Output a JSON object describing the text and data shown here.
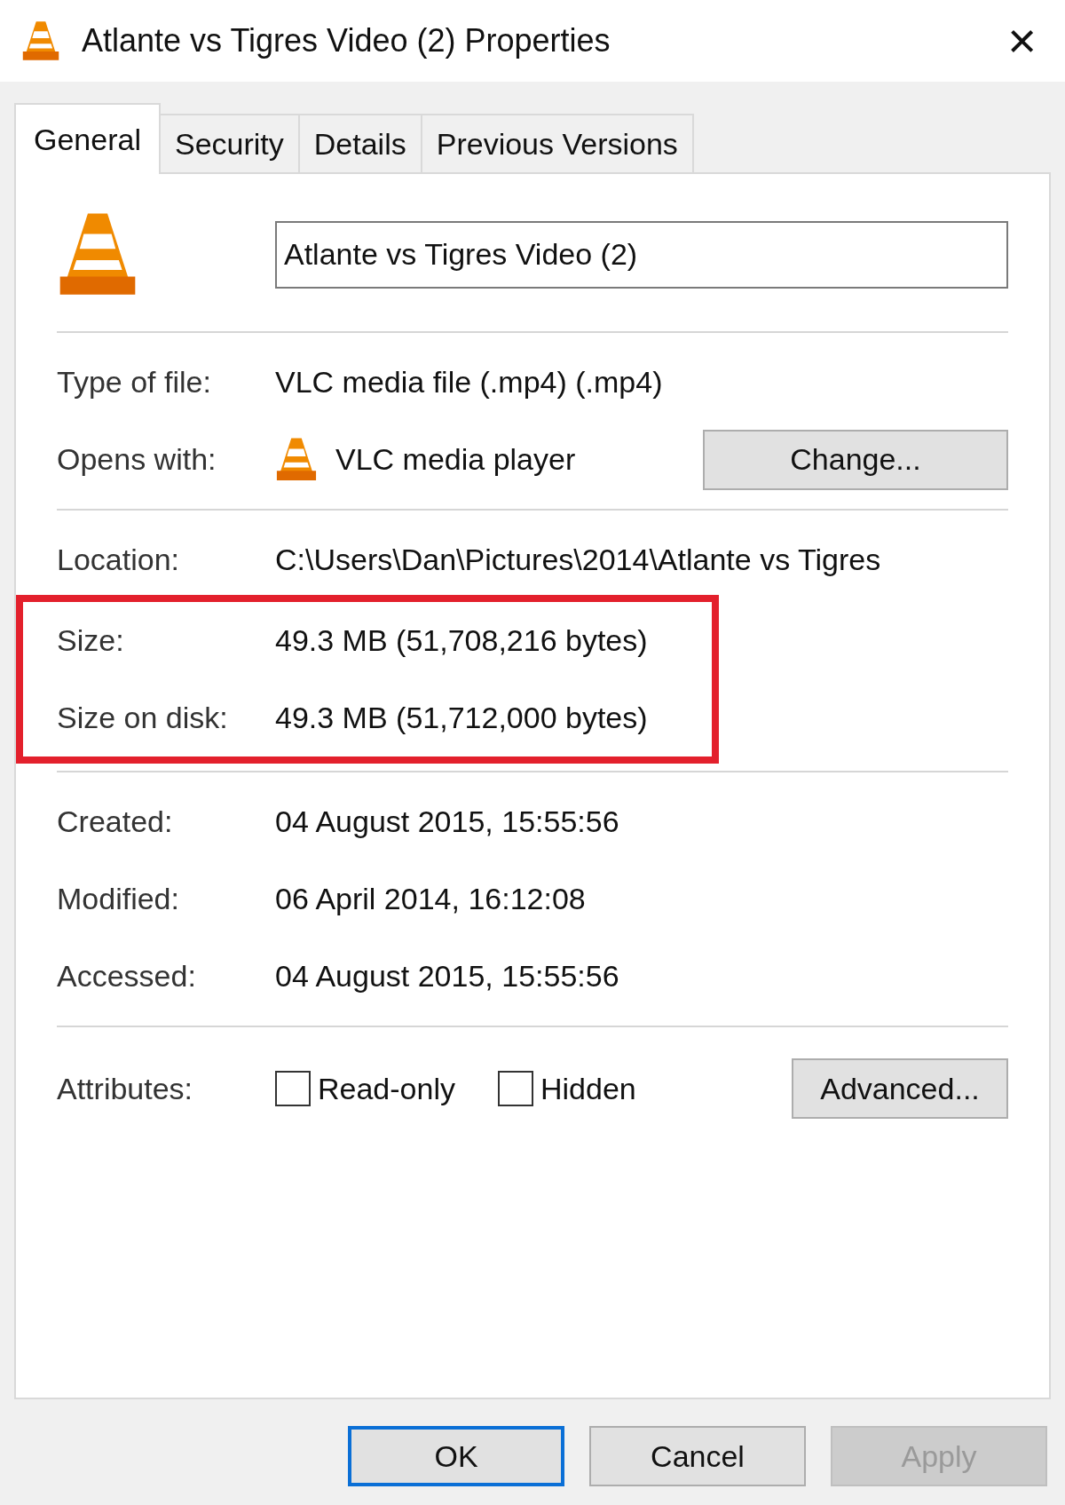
{
  "window": {
    "title": "Atlante vs Tigres Video (2) Properties",
    "close": "×"
  },
  "tabs": [
    {
      "label": "General",
      "selected": true
    },
    {
      "label": "Security",
      "selected": false
    },
    {
      "label": "Details",
      "selected": false
    },
    {
      "label": "Previous Versions",
      "selected": false
    }
  ],
  "file_name": "Atlante vs Tigres Video (2)",
  "sections": [
    {
      "rows": [
        {
          "kind": "text",
          "label": "Type of file:",
          "value": "VLC media file (.mp4) (.mp4)",
          "highlighted": false
        },
        {
          "kind": "app",
          "label": "Opens with:",
          "value": "VLC media player",
          "button": "Change...",
          "highlighted": false
        }
      ]
    },
    {
      "rows": [
        {
          "kind": "text",
          "label": "Location:",
          "value": "C:\\Users\\Dan\\Pictures\\2014\\Atlante vs Tigres",
          "highlighted": false
        },
        {
          "kind": "text",
          "label": "Size:",
          "value": "49.3 MB (51,708,216 bytes)",
          "highlighted": true
        },
        {
          "kind": "text",
          "label": "Size on disk:",
          "value": "49.3 MB (51,712,000 bytes)",
          "highlighted": true
        }
      ]
    },
    {
      "rows": [
        {
          "kind": "text",
          "label": "Created:",
          "value": "04 August 2015, 15:55:56",
          "highlighted": false
        },
        {
          "kind": "text",
          "label": "Modified:",
          "value": "06 April 2014, 16:12:08",
          "highlighted": false
        },
        {
          "kind": "text",
          "label": "Accessed:",
          "value": "04 August 2015, 15:55:56",
          "highlighted": false
        }
      ]
    }
  ],
  "attributes": {
    "label": "Attributes:",
    "checkboxes": [
      {
        "label": "Read-only",
        "checked": false
      },
      {
        "label": "Hidden",
        "checked": false
      }
    ],
    "button": "Advanced..."
  },
  "buttons": [
    {
      "label": "OK",
      "default": true,
      "disabled": false
    },
    {
      "label": "Cancel",
      "default": false,
      "disabled": false
    },
    {
      "label": "Apply",
      "default": false,
      "disabled": true
    }
  ]
}
